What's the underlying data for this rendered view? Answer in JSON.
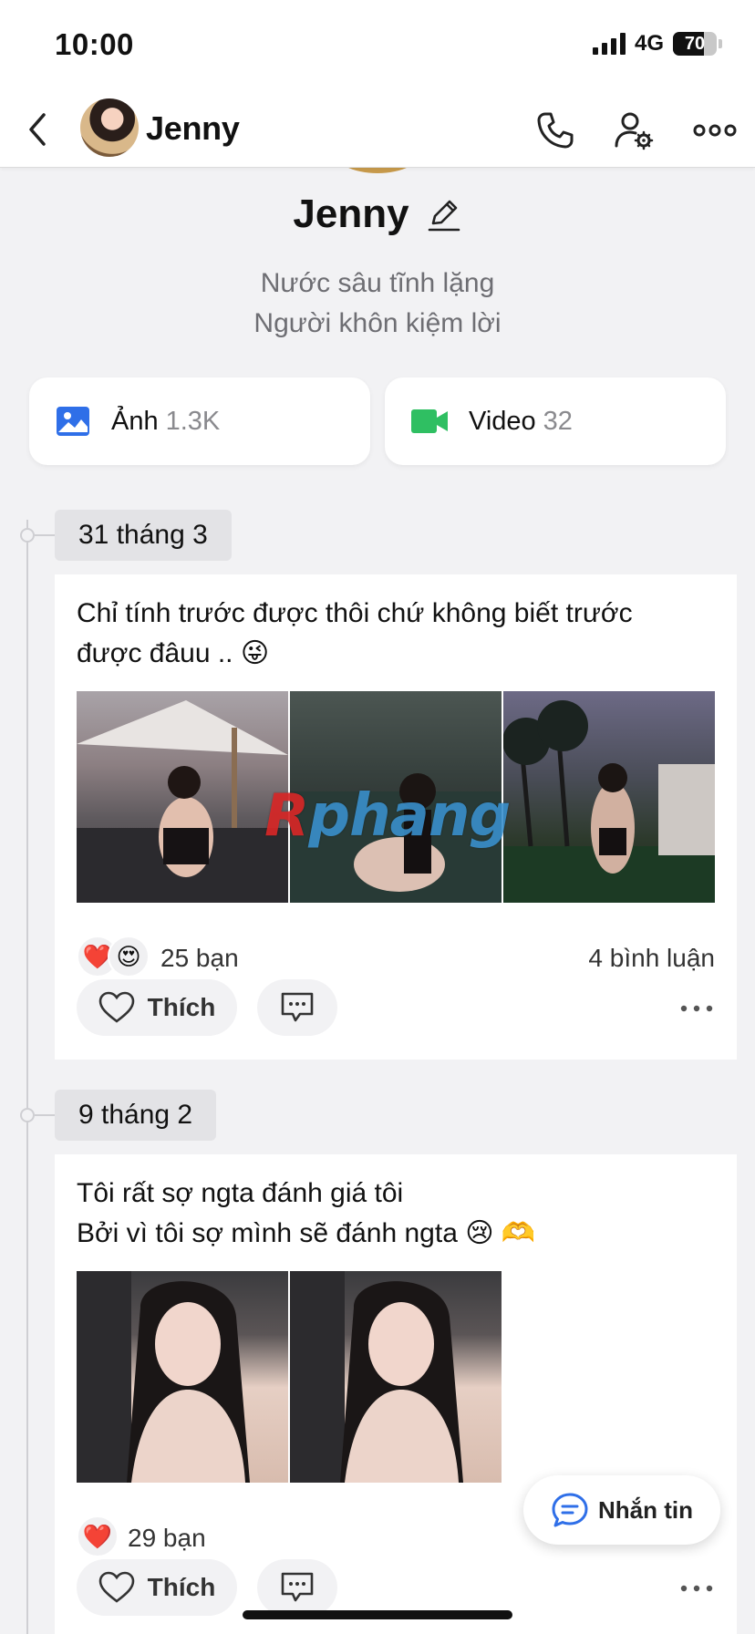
{
  "status_bar": {
    "time": "10:00",
    "network": "4G",
    "battery": "70",
    "battery_level": 0.7
  },
  "header": {
    "name": "Jenny"
  },
  "profile": {
    "name": "Jenny",
    "bio_line1": "Nước sâu tĩnh lặng",
    "bio_line2": "Người khôn kiệm lời"
  },
  "media": {
    "photos_label": "Ảnh",
    "photos_count": "1.3K",
    "videos_label": "Video",
    "videos_count": "32"
  },
  "watermark": {
    "part1": "R",
    "part2": "phang"
  },
  "posts": [
    {
      "date": "31 tháng 3",
      "text_line1": "Chỉ tính trước được thôi chứ không biết trước",
      "text_line2": "được đâuu .. 😜",
      "reactions": [
        "❤️",
        "😍"
      ],
      "reaction_count": "25 bạn",
      "comment_count": "4 bình luận",
      "like_label": "Thích"
    },
    {
      "date": "9 tháng 2",
      "text_line1": "Tôi rất sợ ngta đánh giá tôi",
      "text_line2": "Bởi vì tôi sợ mình sẽ đánh ngta 😢 🫶",
      "reactions": [
        "❤️"
      ],
      "reaction_count": "29 bạn",
      "like_label": "Thích"
    }
  ],
  "fab": {
    "label": "Nhắn tin"
  },
  "colors": {
    "accent_blue": "#2f6fe8",
    "video_green": "#2fbf62",
    "heart_red": "#e8262e"
  }
}
